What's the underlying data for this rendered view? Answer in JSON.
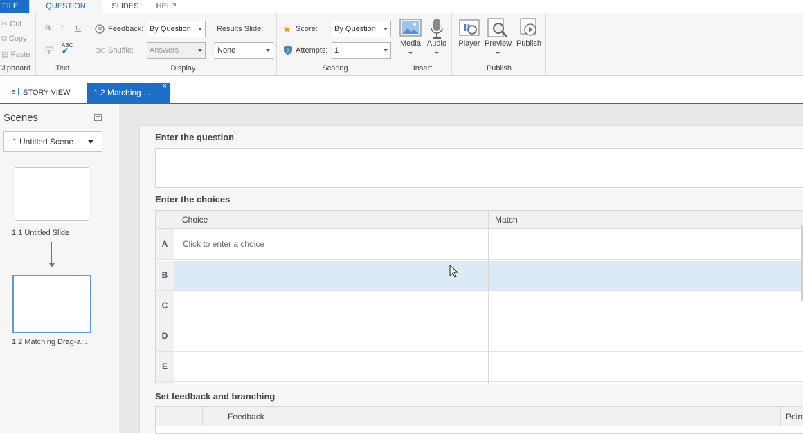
{
  "ribbon_tabs": [
    "FILE",
    "QUESTION",
    "SLIDES",
    "HELP"
  ],
  "clipboard": {
    "cut": "Cut",
    "copy": "Copy",
    "paste": "Paste",
    "label": "Clipboard"
  },
  "text_group": {
    "bold": "B",
    "italic": "I",
    "underline": "U",
    "spell": "ABC",
    "label": "Text"
  },
  "display": {
    "feedback_label": "Feedback:",
    "feedback_value": "By Question",
    "shuffle_label": "Shuffle:",
    "shuffle_value": "Answers",
    "results_label": "Results Slide:",
    "results_value": "None",
    "label": "Display"
  },
  "scoring": {
    "score_label": "Score:",
    "score_value": "By Question",
    "attempts_label": "Attempts:",
    "attempts_value": "1",
    "label": "Scoring"
  },
  "insert": {
    "media": "Media",
    "audio": "Audio",
    "label": "Insert"
  },
  "publish": {
    "player": "Player",
    "preview": "Preview",
    "publish": "Publish",
    "label": "Publish"
  },
  "doc_tabs": {
    "story_view": "STORY VIEW",
    "active": "1.2 Matching ...",
    "close": "×"
  },
  "scenes": {
    "title": "Scenes",
    "selected_scene": "1 Untitled Scene",
    "slides": [
      "1.1 Untitled Slide",
      "1.2 Matching Drag-a..."
    ]
  },
  "editor": {
    "question_title": "Enter the question",
    "choices_title": "Enter the choices",
    "col_choice": "Choice",
    "col_match": "Match",
    "rows": [
      {
        "letter": "A",
        "choice": "Click to enter a choice"
      },
      {
        "letter": "B",
        "choice": ""
      },
      {
        "letter": "C",
        "choice": ""
      },
      {
        "letter": "D",
        "choice": ""
      },
      {
        "letter": "E",
        "choice": ""
      }
    ],
    "feedback_title": "Set feedback and branching",
    "col_feedback": "Feedback",
    "col_points": "Points"
  },
  "colors": {
    "accent": "#1e6fc4",
    "highlight_row": "#dbeaf5"
  }
}
